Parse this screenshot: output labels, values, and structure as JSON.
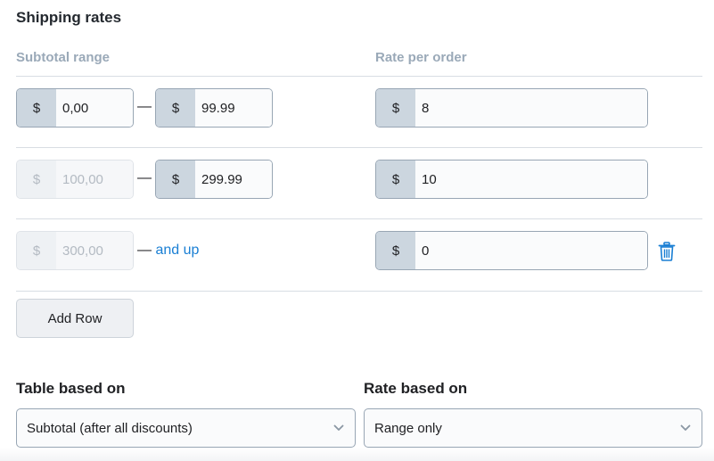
{
  "section": {
    "title": "Shipping rates",
    "columns": {
      "subtotal_range": "Subtotal range",
      "rate_per_order": "Rate per order"
    }
  },
  "currency_symbol": "$",
  "rows": [
    {
      "from": "0,00",
      "from_disabled": false,
      "separator": "—",
      "to": "99.99",
      "rate": "8"
    },
    {
      "from": "100,00",
      "from_disabled": true,
      "separator": "—",
      "to": "299.99",
      "rate": "10"
    },
    {
      "from": "300,00",
      "from_disabled": true,
      "separator": "—",
      "to_text": "and up",
      "rate": "0",
      "deletable": true
    }
  ],
  "add_row_label": "Add Row",
  "table_based_on": {
    "label": "Table based on",
    "value": "Subtotal (after all discounts)"
  },
  "rate_based_on": {
    "label": "Rate based on",
    "value": "Range only"
  },
  "colors": {
    "link": "#1a7fd4",
    "prefix_bg": "#ccd6df",
    "header_text": "#9aa9b8"
  }
}
